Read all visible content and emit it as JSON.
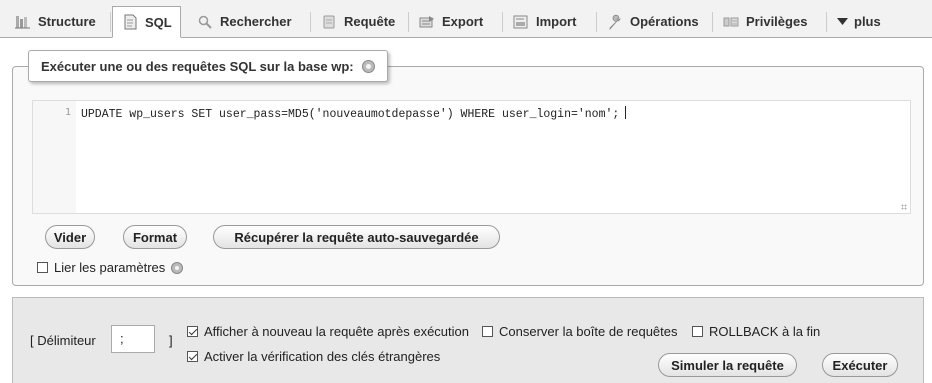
{
  "tabs": [
    {
      "label": "Structure",
      "icon": "structure-icon"
    },
    {
      "label": "SQL",
      "icon": "sql-icon"
    },
    {
      "label": "Rechercher",
      "icon": "search-icon"
    },
    {
      "label": "Requête",
      "icon": "query-icon"
    },
    {
      "label": "Export",
      "icon": "export-icon"
    },
    {
      "label": "Import",
      "icon": "import-icon"
    },
    {
      "label": "Opérations",
      "icon": "wrench-icon"
    },
    {
      "label": "Privilèges",
      "icon": "privileges-icon"
    },
    {
      "label": "plus",
      "icon": "caret-down-icon"
    }
  ],
  "active_tab": "SQL",
  "sql_box": {
    "legend": "Exécuter une ou des requêtes SQL sur la base wp:",
    "line_number": "1",
    "query": "UPDATE wp_users SET user_pass=MD5('nouveaumotdepasse') WHERE user_login='nom';"
  },
  "buttons": {
    "clear": "Vider",
    "format": "Format",
    "recover": "Récupérer la requête auto-sauvegardée",
    "simulate": "Simuler la requête",
    "execute": "Exécuter"
  },
  "bind_params": {
    "label": "Lier les paramètres",
    "checked": false
  },
  "options": {
    "delimiter_open": "[ Délimiteur",
    "delimiter_value": ";",
    "delimiter_close": "]",
    "show_again": {
      "label": "Afficher à nouveau la requête après exécution",
      "checked": true
    },
    "keep_box": {
      "label": "Conserver la boîte de requêtes",
      "checked": false
    },
    "rollback": {
      "label": "ROLLBACK à la fin",
      "checked": false
    },
    "foreign_keys": {
      "label": "Activer la vérification des clés étrangères",
      "checked": true
    }
  }
}
